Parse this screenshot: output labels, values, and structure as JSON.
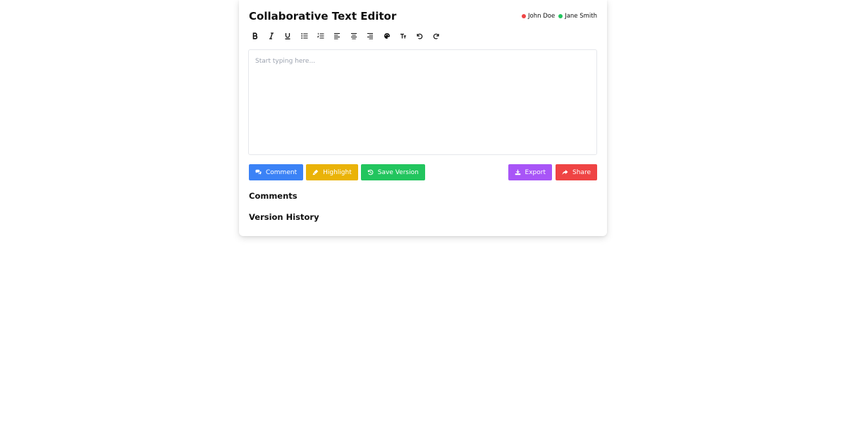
{
  "editor": {
    "title": "Collaborative Text Editor",
    "placeholder": "Start typing here...",
    "users": [
      {
        "name": "John Doe",
        "color": "#ef4444"
      },
      {
        "name": "Jane Smith",
        "color": "#22c55e"
      }
    ]
  },
  "toolbar": {
    "items": [
      {
        "icon": "bold-icon"
      },
      {
        "icon": "italic-icon"
      },
      {
        "icon": "underline-icon"
      },
      {
        "icon": "bullet-list-icon"
      },
      {
        "icon": "numbered-list-icon"
      },
      {
        "icon": "align-left-icon"
      },
      {
        "icon": "align-center-icon"
      },
      {
        "icon": "align-right-icon"
      },
      {
        "icon": "palette-icon"
      },
      {
        "icon": "text-size-icon"
      },
      {
        "icon": "undo-icon"
      },
      {
        "icon": "redo-icon"
      }
    ]
  },
  "actions": {
    "comment": {
      "label": "Comment",
      "icon": "comments-icon",
      "color": "#3b82f6"
    },
    "highlight": {
      "label": "Highlight",
      "icon": "highlighter-icon",
      "color": "#eab308"
    },
    "save_version": {
      "label": "Save Version",
      "icon": "history-icon",
      "color": "#22c55e"
    },
    "export": {
      "label": "Export",
      "icon": "download-icon",
      "color": "#a855f7"
    },
    "share": {
      "label": "Share",
      "icon": "share-icon",
      "color": "#ef4444"
    }
  },
  "sections": {
    "comments": "Comments",
    "version_history": "Version History"
  }
}
